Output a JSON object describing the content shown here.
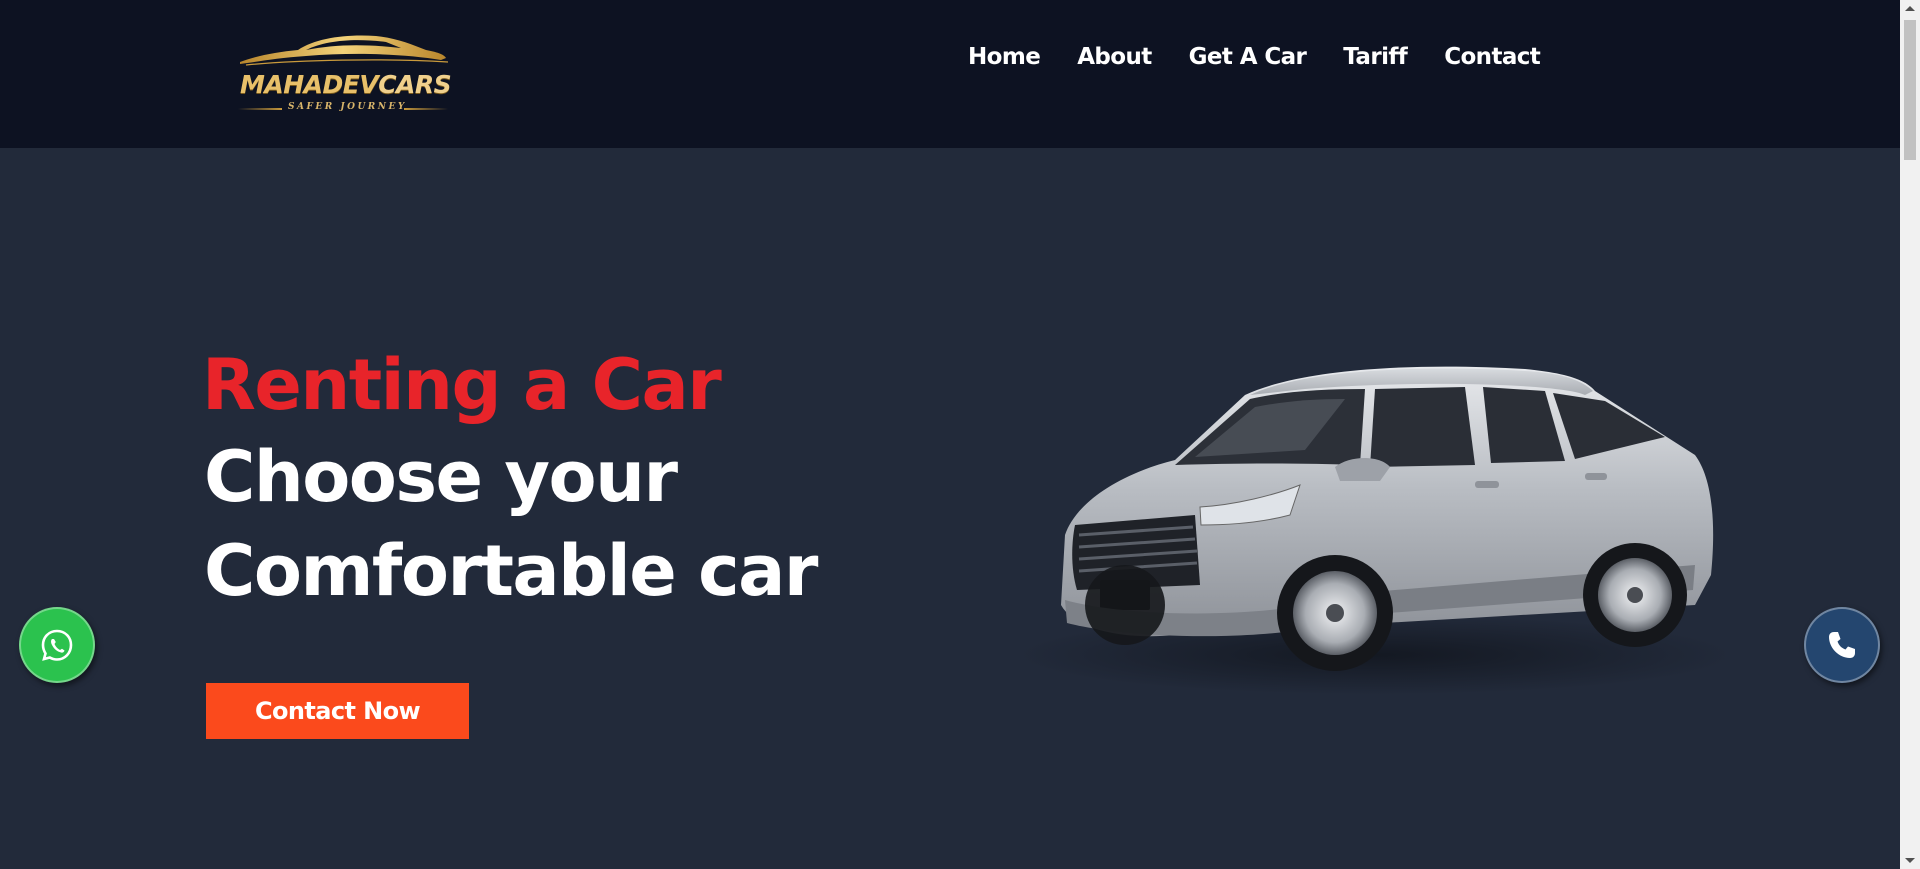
{
  "header": {
    "logo": {
      "brand_primary": "MAHADEV",
      "brand_secondary": "CARS",
      "tagline": "SAFER JOURNEY"
    },
    "nav": [
      {
        "label": "Home"
      },
      {
        "label": "About"
      },
      {
        "label": "Get A Car"
      },
      {
        "label": "Tariff"
      },
      {
        "label": "Contact"
      }
    ]
  },
  "hero": {
    "title_red": "Renting a Car",
    "title_white_line1": "Choose your",
    "title_white_line2": "Comfortable car",
    "cta_label": "Contact Now",
    "image": "silver-mpv-car"
  },
  "floating": {
    "whatsapp_icon": "whatsapp-icon",
    "phone_icon": "phone-icon"
  },
  "colors": {
    "header_bg": "#0d1222",
    "hero_bg": "#222a3a",
    "accent_red": "#e8242a",
    "cta_orange": "#fb4a1c",
    "whatsapp_green": "#2bc24e",
    "phone_blue": "#24466f"
  }
}
